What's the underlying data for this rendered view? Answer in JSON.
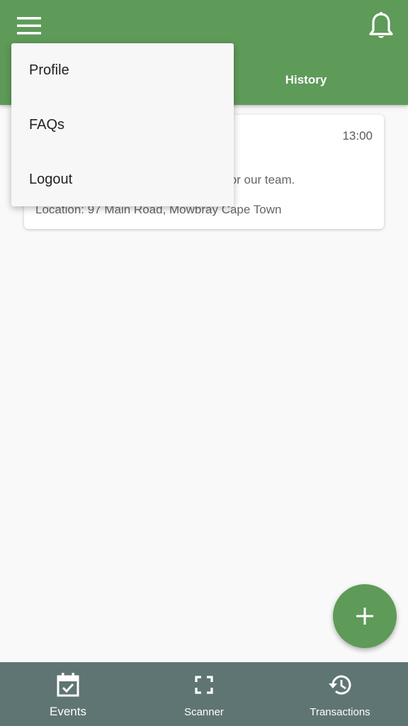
{
  "app_bar": {
    "menu_icon": "hamburger-menu-icon",
    "notification_icon": "bell-icon",
    "tabs": [
      {
        "label": "History"
      }
    ],
    "color": "#5e9a58"
  },
  "menu": {
    "items": [
      {
        "label": "Profile"
      },
      {
        "label": "FAQs"
      },
      {
        "label": "Logout"
      }
    ]
  },
  "event_card": {
    "time": "13:00",
    "description": "for our team.",
    "location": "Location: 97 Main Road, Mowbray Cape Town"
  },
  "fab": {
    "icon": "plus-icon"
  },
  "bottom_nav": {
    "color": "#5f7573",
    "items": [
      {
        "label": "Events",
        "icon": "calendar-check-icon"
      },
      {
        "label": "Scanner",
        "icon": "scan-frame-icon"
      },
      {
        "label": "Transactions",
        "icon": "history-icon"
      }
    ]
  }
}
